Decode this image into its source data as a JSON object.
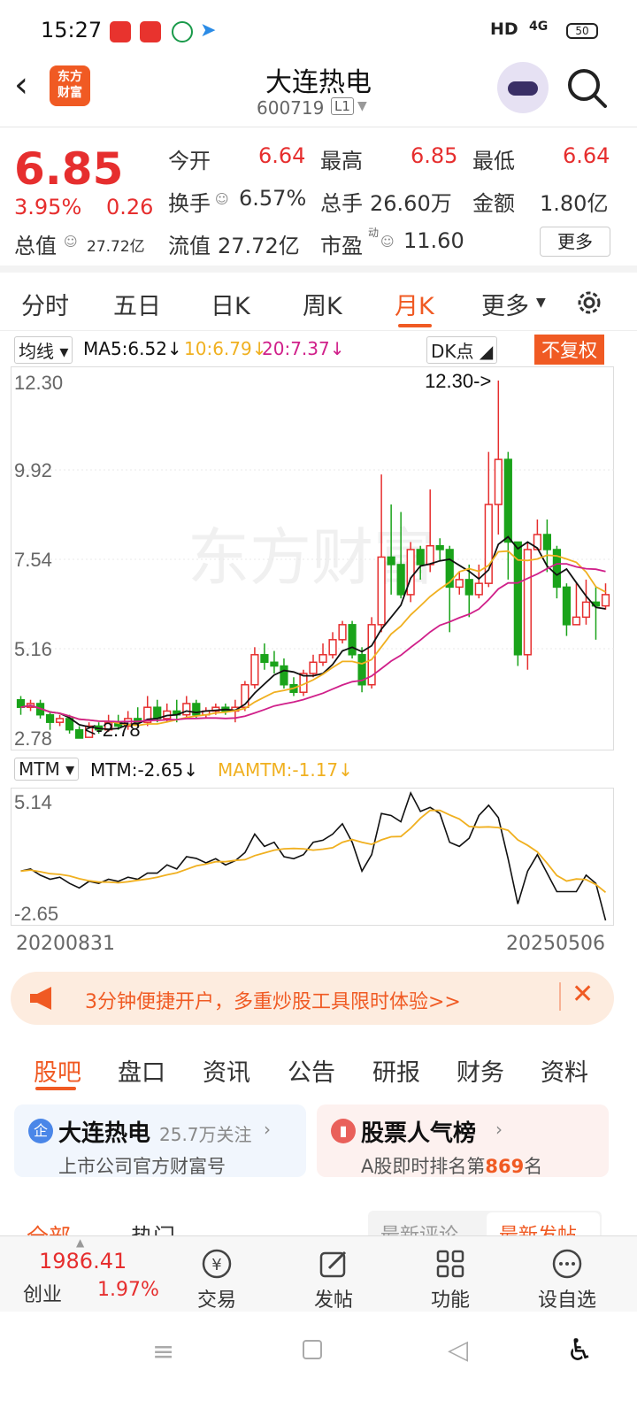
{
  "status_bar": {
    "time": "15:27",
    "network": "HD",
    "signal": "4G",
    "battery": "50"
  },
  "header": {
    "logo_line1": "东方",
    "logo_line2": "财富",
    "stock_name": "大连热电",
    "stock_code": "600719",
    "level_badge": "L1"
  },
  "quote": {
    "price": "6.85",
    "change_pct": "3.95%",
    "change": "0.26",
    "open_label": "今开",
    "open": "6.64",
    "high_label": "最高",
    "high": "6.85",
    "low_label": "最低",
    "low": "6.64",
    "turnover_label": "换手",
    "turnover": "6.57%",
    "volume_label": "总手",
    "volume": "26.60万",
    "amount_label": "金额",
    "amount": "1.80亿",
    "total_cap_label": "总值",
    "total_cap": "27.72亿",
    "float_cap_label": "流值",
    "float_cap": "27.72亿",
    "pe_label": "市盈",
    "pe_mark": "动",
    "pe": "11.60",
    "more_button": "更多"
  },
  "chart_tabs": [
    "分时",
    "五日",
    "日K",
    "周K",
    "月K",
    "更多"
  ],
  "active_tab": "月K",
  "ma_bar": {
    "selector": "均线",
    "ma5": "MA5:6.52↓",
    "ma10": "10:6.79↓",
    "ma20": "20:7.37↓",
    "dk_selector": "DK点",
    "adjust_badge": "不复权",
    "colors": {
      "ma5": "#111111",
      "ma10": "#f0b020",
      "ma20": "#d0208a",
      "up": "#e62e2e",
      "down": "#1aa31a"
    }
  },
  "chart_data": {
    "type": "candlestick",
    "y_ticks": [
      "12.30",
      "9.92",
      "7.54",
      "5.16",
      "2.78"
    ],
    "ylim": [
      2.78,
      12.3
    ],
    "max_label": "12.30->",
    "min_label": "<-2.78",
    "watermark": "东方财富",
    "start_date": "20200831",
    "end_date": "20250506",
    "candles": [
      [
        3.8,
        3.6,
        3.9,
        3.4
      ],
      [
        3.6,
        3.7,
        3.8,
        3.5
      ],
      [
        3.7,
        3.4,
        3.8,
        3.3
      ],
      [
        3.4,
        3.2,
        3.5,
        3.0
      ],
      [
        3.2,
        3.3,
        3.4,
        3.1
      ],
      [
        3.3,
        3.0,
        3.4,
        2.9
      ],
      [
        3.0,
        2.78,
        3.1,
        2.78
      ],
      [
        2.8,
        3.1,
        3.2,
        2.8
      ],
      [
        3.1,
        3.0,
        3.2,
        2.9
      ],
      [
        3.0,
        3.2,
        3.4,
        2.95
      ],
      [
        3.2,
        3.1,
        3.4,
        3.0
      ],
      [
        3.1,
        3.3,
        3.5,
        3.0
      ],
      [
        3.3,
        3.2,
        3.6,
        3.1
      ],
      [
        3.2,
        3.6,
        3.9,
        3.1
      ],
      [
        3.6,
        3.3,
        3.8,
        3.2
      ],
      [
        3.3,
        3.5,
        3.7,
        3.2
      ],
      [
        3.5,
        3.4,
        3.8,
        3.2
      ],
      [
        3.4,
        3.7,
        3.9,
        3.3
      ],
      [
        3.7,
        3.4,
        3.8,
        3.3
      ],
      [
        3.4,
        3.5,
        3.6,
        3.3
      ],
      [
        3.5,
        3.6,
        3.7,
        3.4
      ],
      [
        3.6,
        3.5,
        3.7,
        3.4
      ],
      [
        3.5,
        3.6,
        3.8,
        3.2
      ],
      [
        3.6,
        4.2,
        4.3,
        3.5
      ],
      [
        4.2,
        5.0,
        5.2,
        4.1
      ],
      [
        5.0,
        4.8,
        5.3,
        4.6
      ],
      [
        4.8,
        4.7,
        5.1,
        4.5
      ],
      [
        4.7,
        4.2,
        4.9,
        4.1
      ],
      [
        4.2,
        4.0,
        4.4,
        3.9
      ],
      [
        4.0,
        4.5,
        4.6,
        3.9
      ],
      [
        4.5,
        4.8,
        5.0,
        4.4
      ],
      [
        4.8,
        5.0,
        5.3,
        4.7
      ],
      [
        5.0,
        5.4,
        5.6,
        4.9
      ],
      [
        5.4,
        5.8,
        5.9,
        5.3
      ],
      [
        5.8,
        5.0,
        5.9,
        4.9
      ],
      [
        5.0,
        4.2,
        5.2,
        4.0
      ],
      [
        4.2,
        5.8,
        6.0,
        4.1
      ],
      [
        5.8,
        7.6,
        9.8,
        5.6
      ],
      [
        7.6,
        7.4,
        9.0,
        6.6
      ],
      [
        7.4,
        6.6,
        8.8,
        6.5
      ],
      [
        6.6,
        7.8,
        8.0,
        6.4
      ],
      [
        7.8,
        7.4,
        7.9,
        7.0
      ],
      [
        7.4,
        7.9,
        9.4,
        7.2
      ],
      [
        7.9,
        7.8,
        8.1,
        7.5
      ],
      [
        7.8,
        6.8,
        7.9,
        5.6
      ],
      [
        6.8,
        7.0,
        7.2,
        6.6
      ],
      [
        7.0,
        6.6,
        7.4,
        6.0
      ],
      [
        6.6,
        6.9,
        7.4,
        6.5
      ],
      [
        6.9,
        9.0,
        10.4,
        6.8
      ],
      [
        9.0,
        10.2,
        12.3,
        8.2
      ],
      [
        10.2,
        8.0,
        10.4,
        7.0
      ],
      [
        8.0,
        5.0,
        8.0,
        4.7
      ],
      [
        5.0,
        7.8,
        8.0,
        4.6
      ],
      [
        7.8,
        8.2,
        8.6,
        7.8
      ],
      [
        8.2,
        7.8,
        8.6,
        7.2
      ],
      [
        7.8,
        6.8,
        7.9,
        6.5
      ],
      [
        6.8,
        5.8,
        6.9,
        5.5
      ],
      [
        5.8,
        6.0,
        6.9,
        5.8
      ],
      [
        6.0,
        6.4,
        7.0,
        5.8
      ],
      [
        6.4,
        6.3,
        6.8,
        5.4
      ],
      [
        6.3,
        6.6,
        6.9,
        6.2
      ]
    ],
    "mtm_label": "MTM:-2.65↓",
    "mamtm_label": "MAMTM:-1.17↓",
    "mtm_ticks": [
      "5.14",
      "-2.65"
    ],
    "mtm_ylim": [
      -2.65,
      5.14
    ]
  },
  "banner": {
    "text": "3分钟便捷开户，多重炒股工具限时体验>>"
  },
  "bottom_tabs": [
    "股吧",
    "盘口",
    "资讯",
    "公告",
    "研报",
    "财务",
    "资料"
  ],
  "active_bottom_tab": "股吧",
  "card1": {
    "title": "大连热电",
    "follow": "25.7万关注",
    "subtitle": "上市公司官方财富号"
  },
  "card2": {
    "title": "股票人气榜",
    "subtitle_pre": "A股即时排名第",
    "rank": "869",
    "subtitle_post": "名"
  },
  "sub_tabs": [
    "全部",
    "热门",
    "最新评论",
    "最新发帖"
  ],
  "bottom_nav": {
    "index_value": "1986.41",
    "index_name": "创业",
    "index_pct": "1.97%",
    "trade": "交易",
    "post": "发帖",
    "functions": "功能",
    "watchlist": "设自选"
  }
}
